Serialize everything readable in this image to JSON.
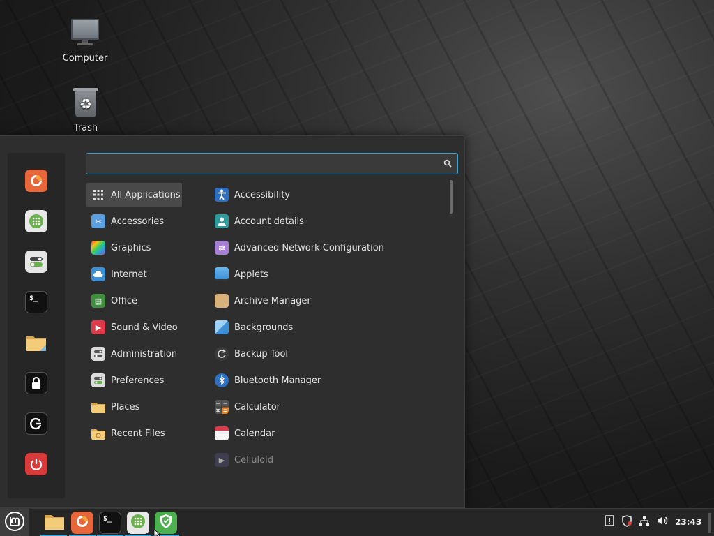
{
  "desktop": {
    "icons": [
      {
        "label": "Computer",
        "icon": "computer-icon"
      },
      {
        "label": "Trash",
        "icon": "trash-icon"
      }
    ]
  },
  "menu": {
    "search": {
      "value": "",
      "placeholder": ""
    },
    "favorites": [
      {
        "name": "firefox",
        "icon": "firefox-icon",
        "color": "#e8673a"
      },
      {
        "name": "software-manager",
        "icon": "software-manager-icon",
        "color": "#6ab04c"
      },
      {
        "name": "settings",
        "icon": "toggle-settings-icon",
        "color": "#e6e6e6"
      },
      {
        "name": "terminal",
        "icon": "terminal-icon",
        "color": "#111111"
      },
      {
        "name": "files",
        "icon": "folder-icon",
        "color": "#f0c36a"
      },
      {
        "name": "lock-screen",
        "icon": "lock-icon",
        "color": "#111111"
      },
      {
        "name": "logout",
        "icon": "logout-icon",
        "color": "#111111"
      },
      {
        "name": "shutdown",
        "icon": "power-icon",
        "color": "#d93b3b"
      }
    ],
    "categories": [
      {
        "label": "All Applications",
        "icon": "grid-icon",
        "selected": true
      },
      {
        "label": "Accessories",
        "icon": "scissors-icon"
      },
      {
        "label": "Graphics",
        "icon": "graphics-icon"
      },
      {
        "label": "Internet",
        "icon": "cloud-icon"
      },
      {
        "label": "Office",
        "icon": "office-icon"
      },
      {
        "label": "Sound & Video",
        "icon": "play-icon"
      },
      {
        "label": "Administration",
        "icon": "admin-icon"
      },
      {
        "label": "Preferences",
        "icon": "preferences-icon"
      },
      {
        "label": "Places",
        "icon": "folder-icon"
      },
      {
        "label": "Recent Files",
        "icon": "recent-folder-icon"
      }
    ],
    "apps": [
      {
        "label": "Accessibility",
        "icon": "accessibility-icon"
      },
      {
        "label": "Account details",
        "icon": "account-icon"
      },
      {
        "label": "Advanced Network Configuration",
        "icon": "network-config-icon"
      },
      {
        "label": "Applets",
        "icon": "applets-icon"
      },
      {
        "label": "Archive Manager",
        "icon": "archive-icon"
      },
      {
        "label": "Backgrounds",
        "icon": "backgrounds-icon"
      },
      {
        "label": "Backup Tool",
        "icon": "backup-icon"
      },
      {
        "label": "Bluetooth Manager",
        "icon": "bluetooth-icon"
      },
      {
        "label": "Calculator",
        "icon": "calculator-icon"
      },
      {
        "label": "Calendar",
        "icon": "calendar-icon"
      },
      {
        "label": "Celluloid",
        "icon": "celluloid-icon",
        "dimmed": true
      }
    ]
  },
  "panel": {
    "pinned": [
      {
        "name": "files",
        "icon": "folder-icon"
      },
      {
        "name": "firefox",
        "icon": "firefox-icon"
      },
      {
        "name": "terminal",
        "icon": "terminal-icon"
      },
      {
        "name": "software-manager",
        "icon": "software-manager-icon"
      },
      {
        "name": "update-manager",
        "icon": "shield-icon"
      }
    ],
    "tray": [
      {
        "name": "notifications",
        "icon": "notification-icon"
      },
      {
        "name": "update-status",
        "icon": "update-shield-icon"
      },
      {
        "name": "network",
        "icon": "network-icon"
      },
      {
        "name": "volume",
        "icon": "volume-icon"
      }
    ],
    "clock": "23:43"
  },
  "colors": {
    "accent": "#3fa4d1",
    "menu_bg": "#2e2e2e",
    "panel_bg": "#262626"
  }
}
